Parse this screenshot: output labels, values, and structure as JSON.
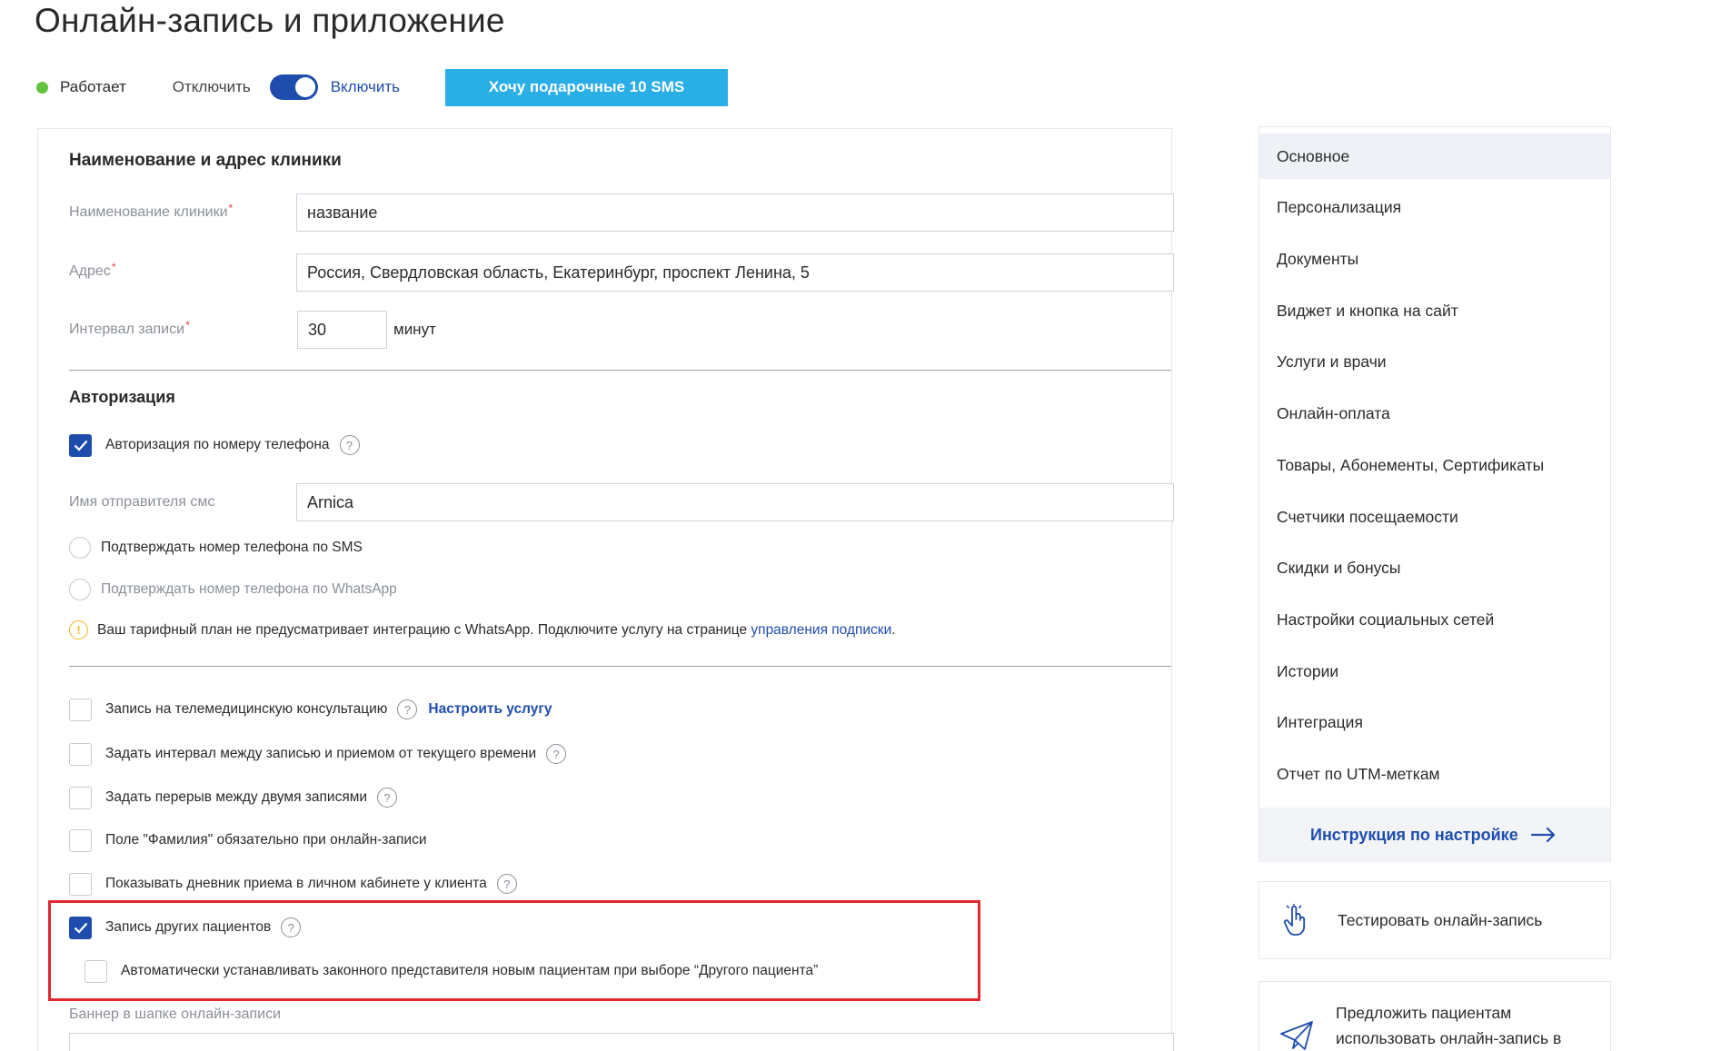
{
  "page": {
    "title": "Онлайн-запись и приложение"
  },
  "status": {
    "state_label": "Работает",
    "off_label": "Отключить",
    "on_label": "Включить",
    "toggle_on": true,
    "gift_button": "Хочу подарочные 10 SMS"
  },
  "clinic": {
    "section_title": "Наименование и адрес клиники",
    "name_label": "Наименование клиники",
    "name_value": "название",
    "address_label": "Адрес",
    "address_value": "Россия, Свердловская область, Екатеринбург, проспект Ленина, 5",
    "interval_label": "Интервал записи",
    "interval_value": "30",
    "interval_unit": "минут",
    "required_mark": "*"
  },
  "auth": {
    "section_title": "Авторизация",
    "phone_auth_label": "Авторизация по номеру телефона",
    "phone_auth_checked": true,
    "sender_label": "Имя отправителя смс",
    "sender_value": "Arnica",
    "confirm_sms_label": "Подтверждать номер телефона по SMS",
    "confirm_whatsapp_label": "Подтверждать номер телефона по WhatsApp",
    "warning_icon": "!",
    "warning_text": "Ваш тарифный план не предусматривает интеграцию с WhatsApp. Подключите услугу на странице ",
    "warning_link": "управления подписки",
    "warning_end": "."
  },
  "options": {
    "telemed_label": "Запись на телемедицинскую консультацию",
    "telemed_link": "Настроить услугу",
    "interval_label": "Задать интервал между записью и приемом от текущего времени",
    "break_label": "Задать перерыв между двумя записями",
    "surname_label": "Поле \"Фамилия\" обязательно при онлайн-записи",
    "diary_label": "Показывать дневник приема в личном кабинете у клиента",
    "other_patients_label": "Запись других пациентов",
    "other_patients_checked": true,
    "legal_rep_label": "Автоматически устанавливать законного представителя новым пациентам при выборе “Другого пациента”",
    "help_glyph": "?"
  },
  "banner": {
    "label": "Баннер в шапке онлайн-записи"
  },
  "sidebar": {
    "items": [
      {
        "label": "Основное",
        "active": true
      },
      {
        "label": "Персонализация"
      },
      {
        "label": "Документы"
      },
      {
        "label": "Виджет и кнопка на сайт"
      },
      {
        "label": "Услуги и врачи"
      },
      {
        "label": "Онлайн-оплата"
      },
      {
        "label": "Товары, Абонементы, Сертификаты"
      },
      {
        "label": "Счетчики посещаемости"
      },
      {
        "label": "Скидки и бонусы"
      },
      {
        "label": "Настройки социальных сетей"
      },
      {
        "label": "Истории"
      },
      {
        "label": "Интеграция"
      },
      {
        "label": "Отчет по UTM-меткам"
      }
    ],
    "footer_label": "Инструкция по настройке"
  },
  "side_cards": {
    "test_label": "Тестировать онлайн-запись",
    "sms_promo_label": "Предложить пациентам использовать онлайн-запись в SMS-рассылке"
  },
  "colors": {
    "accent": "#1e4dae",
    "button": "#2aaee6",
    "status_ok": "#62c23b",
    "highlight": "#e0282e",
    "warning": "#f5b820"
  }
}
